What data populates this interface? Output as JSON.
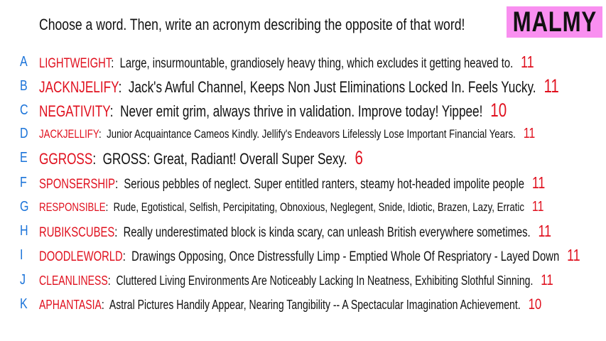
{
  "header": {
    "prompt": "Choose a word. Then, write an acronym describing the opposite of that word!",
    "badge": "MALMY"
  },
  "colors": {
    "letter": "#1a73d9",
    "word": "#e0101e",
    "badge_bg": "#f98ff0"
  },
  "rows": [
    {
      "letter": "A",
      "word": "LIGHTWEIGHT",
      "text": "Large, insurmountable, grandiosely heavy thing, which excludes it getting heaved to.",
      "score": "11"
    },
    {
      "letter": "B",
      "word": "JACKNJELIFY",
      "text": "Jack's Awful Channel, Keeps Non Just Eliminations Locked In. Feels Yucky.",
      "score": "11"
    },
    {
      "letter": "C",
      "word": "NEGATIVITY",
      "text": "Never emit grim, always thrive in validation. Improve today! Yippee!",
      "score": "10"
    },
    {
      "letter": "D",
      "word": "JACKJELLIFY",
      "text": "Junior Acquaintance Cameos Kindly. Jellify's Endeavors Lifelessly Lose Important Financial Years.",
      "score": "11"
    },
    {
      "letter": "E",
      "word": "GGROSS",
      "text": "GROSS: Great, Radiant! Overall Super Sexy.",
      "score": "6"
    },
    {
      "letter": "F",
      "word": "SPONSERSHIP",
      "text": "Serious pebbles of neglect. Super entitled ranters, steamy hot-headed impolite people",
      "score": "11"
    },
    {
      "letter": "G",
      "word": "RESPONSIBLE",
      "text": "Rude, Egotistical, Selfish, Percipitating, Obnoxious, Neglegent, Snide, Idiotic, Brazen, Lazy, Erratic",
      "score": "11"
    },
    {
      "letter": "H",
      "word": "RUBIKSCUBES",
      "text": "Really underestimated block is kinda scary, can unleash British everywhere sometimes.",
      "score": "11"
    },
    {
      "letter": "I",
      "word": "DOODLEWORLD",
      "text": "Drawings Opposing, Once Distressfully Limp - Emptied Whole Of Respriatory - Layed Down",
      "score": "11"
    },
    {
      "letter": "J",
      "word": "CLEANLINESS",
      "text": "Cluttered Living Environments Are Noticeably Lacking In Neatness, Exhibiting Slothful Sinning.",
      "score": "11"
    },
    {
      "letter": "K",
      "word": "APHANTASIA",
      "text": "Astral Pictures Handily Appear, Nearing Tangibility -- A Spectacular Imagination Achievement.",
      "score": "10"
    }
  ]
}
